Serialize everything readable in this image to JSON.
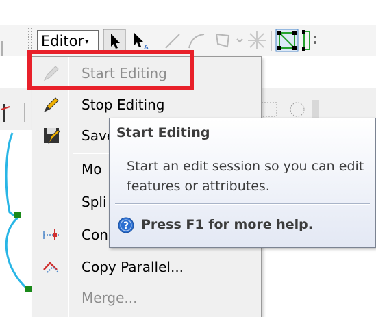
{
  "toolbar": {
    "editor_label": "Editor",
    "editor_arrow": "▾"
  },
  "menu": {
    "items": [
      {
        "label": "Start Editing",
        "enabled": false,
        "icon": "start-editing-pencil-icon"
      },
      {
        "label": "Stop Editing",
        "enabled": true,
        "icon": "stop-editing-pencil-icon"
      },
      {
        "label": "Save",
        "enabled": true,
        "icon": "save-edits-icon"
      },
      {
        "label": "Mo",
        "enabled": true,
        "icon": ""
      },
      {
        "label": "Spli",
        "enabled": true,
        "icon": ""
      },
      {
        "label": "Con",
        "enabled": true,
        "icon": "construct-points-icon"
      },
      {
        "label": "Copy Parallel...",
        "enabled": true,
        "icon": "copy-parallel-icon"
      },
      {
        "label": "Merge...",
        "enabled": false,
        "icon": ""
      }
    ]
  },
  "tooltip": {
    "title": "Start Editing",
    "body": "Start an edit session so you can edit features or attributes.",
    "help": "Press F1 for more help."
  },
  "colors": {
    "highlight_border": "#e8202a",
    "disabled_text": "#8d8d8d",
    "sketch_line": "#29b6e6",
    "vertex": "#1a8a1a",
    "help_icon": "#2c6fd1"
  }
}
